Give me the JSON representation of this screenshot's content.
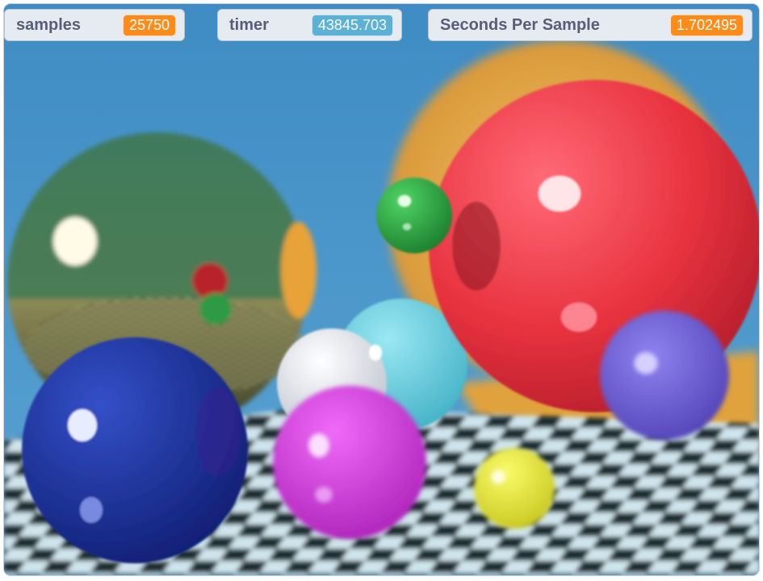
{
  "monitors": {
    "samples": {
      "label": "samples",
      "value": "25750"
    },
    "timer": {
      "label": "timer",
      "value": "43845.703"
    },
    "seconds_per_sample": {
      "label": "Seconds Per Sample",
      "value": "1.702495"
    }
  },
  "colors": {
    "sky": "#4a96c8",
    "monitor_bg": "#e6ebf1",
    "monitor_text": "#575e75",
    "variable_orange": "#ff8c1a",
    "sensing_blue": "#5cb1d6",
    "red_sphere": "#f0404e",
    "green_sphere": "#2fa845",
    "dark_blue_sphere": "#1b2f9a",
    "magenta_sphere": "#d33be0",
    "cyan_sphere": "#6ad2e4",
    "white_sphere": "#e8ecf4",
    "yellow_sphere": "#e6e62a",
    "violet_sphere": "#6f5fd8",
    "mirror_sphere": "#3f7a5c",
    "gold_sphere": "#e3a54a"
  }
}
